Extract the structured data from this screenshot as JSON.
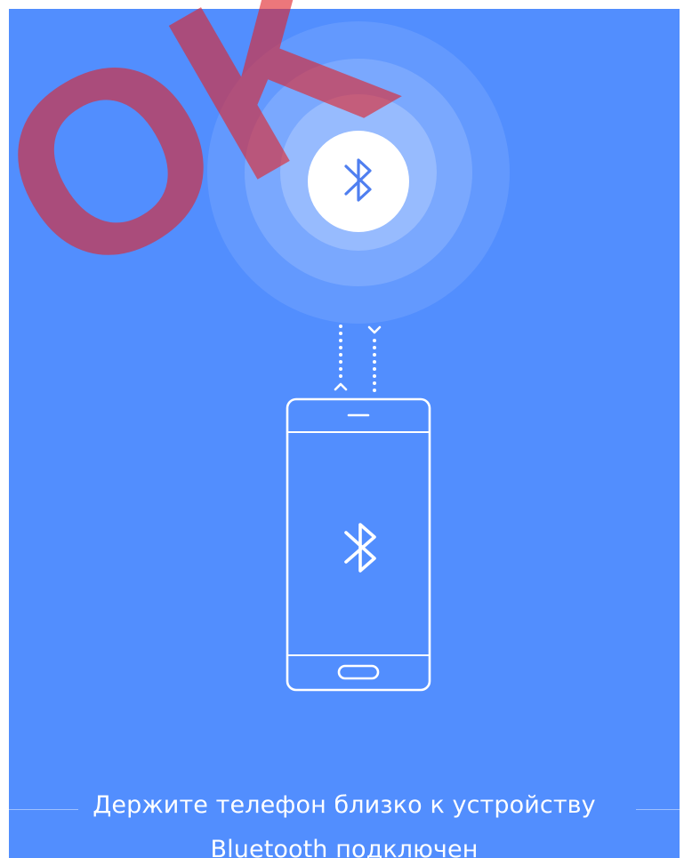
{
  "screen": {
    "background_color": "#528efe",
    "accent_color": "#4f7ff0"
  },
  "watermark": {
    "text": "OK",
    "color": "#e0242a"
  },
  "illustration": {
    "top_icon": "bluetooth-icon",
    "phone_icon": "bluetooth-icon",
    "signal_arrows": [
      "arrow-up-icon",
      "arrow-down-icon"
    ]
  },
  "caption": {
    "primary": "Держите телефон близко к устройству",
    "secondary": "Bluetooth подключен"
  }
}
